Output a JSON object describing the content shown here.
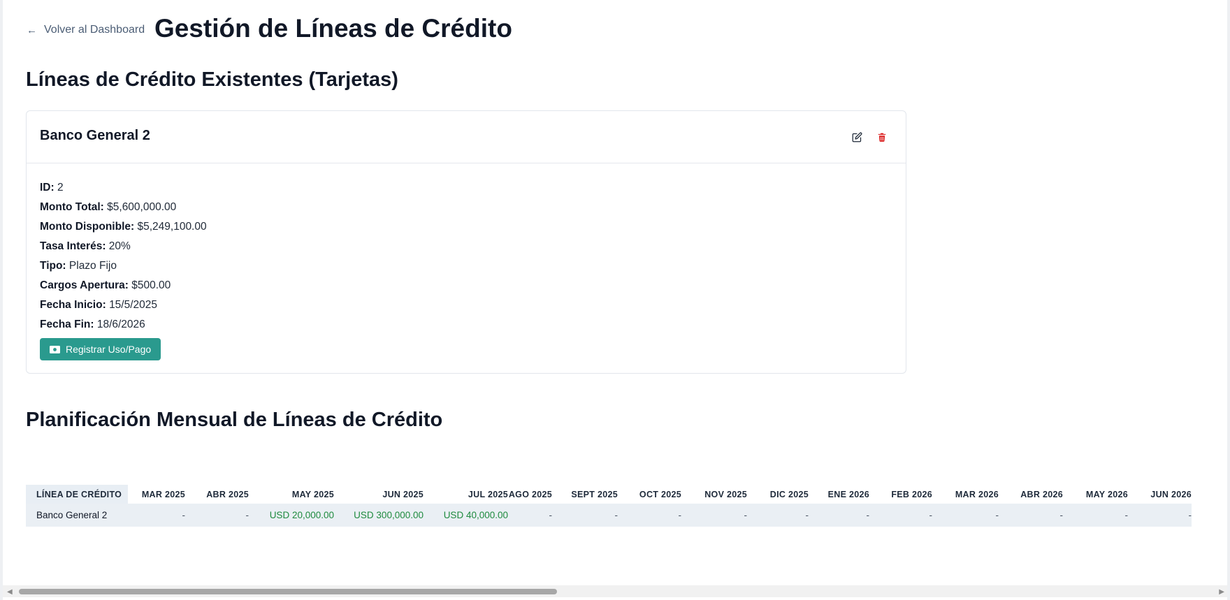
{
  "nav": {
    "back_label": "Volver al Dashboard"
  },
  "page_title": "Gestión de Líneas de Crédito",
  "existing_section": {
    "title": "Líneas de Crédito Existentes (Tarjetas)"
  },
  "card": {
    "title": "Banco General 2",
    "edit_icon": "edit-icon",
    "delete_icon": "trash-icon",
    "fields": [
      {
        "label": "ID:",
        "value": "2"
      },
      {
        "label": "Monto Total:",
        "value": "$5,600,000.00"
      },
      {
        "label": "Monto Disponible:",
        "value": "$5,249,100.00"
      },
      {
        "label": "Tasa Interés:",
        "value": "20%"
      },
      {
        "label": "Tipo:",
        "value": "Plazo Fijo"
      },
      {
        "label": "Cargos Apertura:",
        "value": "$500.00"
      },
      {
        "label": "Fecha Inicio:",
        "value": "15/5/2025"
      },
      {
        "label": "Fecha Fin:",
        "value": "18/6/2026"
      }
    ],
    "register_button": "Registrar Uso/Pago",
    "register_icon": "money-icon"
  },
  "planning_section": {
    "title": "Planificación Mensual de Líneas de Crédito",
    "columns": [
      "LÍNEA DE CRÉDITO",
      "MAR 2025",
      "ABR 2025",
      "MAY 2025",
      "JUN 2025",
      "JUL 2025",
      "AGO 2025",
      "SEPT 2025",
      "OCT 2025",
      "NOV 2025",
      "DIC 2025",
      "ENE 2026",
      "FEB 2026",
      "MAR 2026",
      "ABR 2026",
      "MAY 2026",
      "JUN 2026"
    ],
    "rows": [
      {
        "name": "Banco General 2",
        "cells": [
          "-",
          "-",
          "USD 20,000.00",
          "USD 300,000.00",
          "USD 40,000.00",
          "-",
          "-",
          "-",
          "-",
          "-",
          "-",
          "-",
          "-",
          "-",
          "-",
          "-"
        ]
      }
    ]
  },
  "colors": {
    "accent": "#2a9a8e",
    "delete": "#dc2626",
    "positive": "#1e8a3e",
    "table_row": "#eaeff4"
  }
}
